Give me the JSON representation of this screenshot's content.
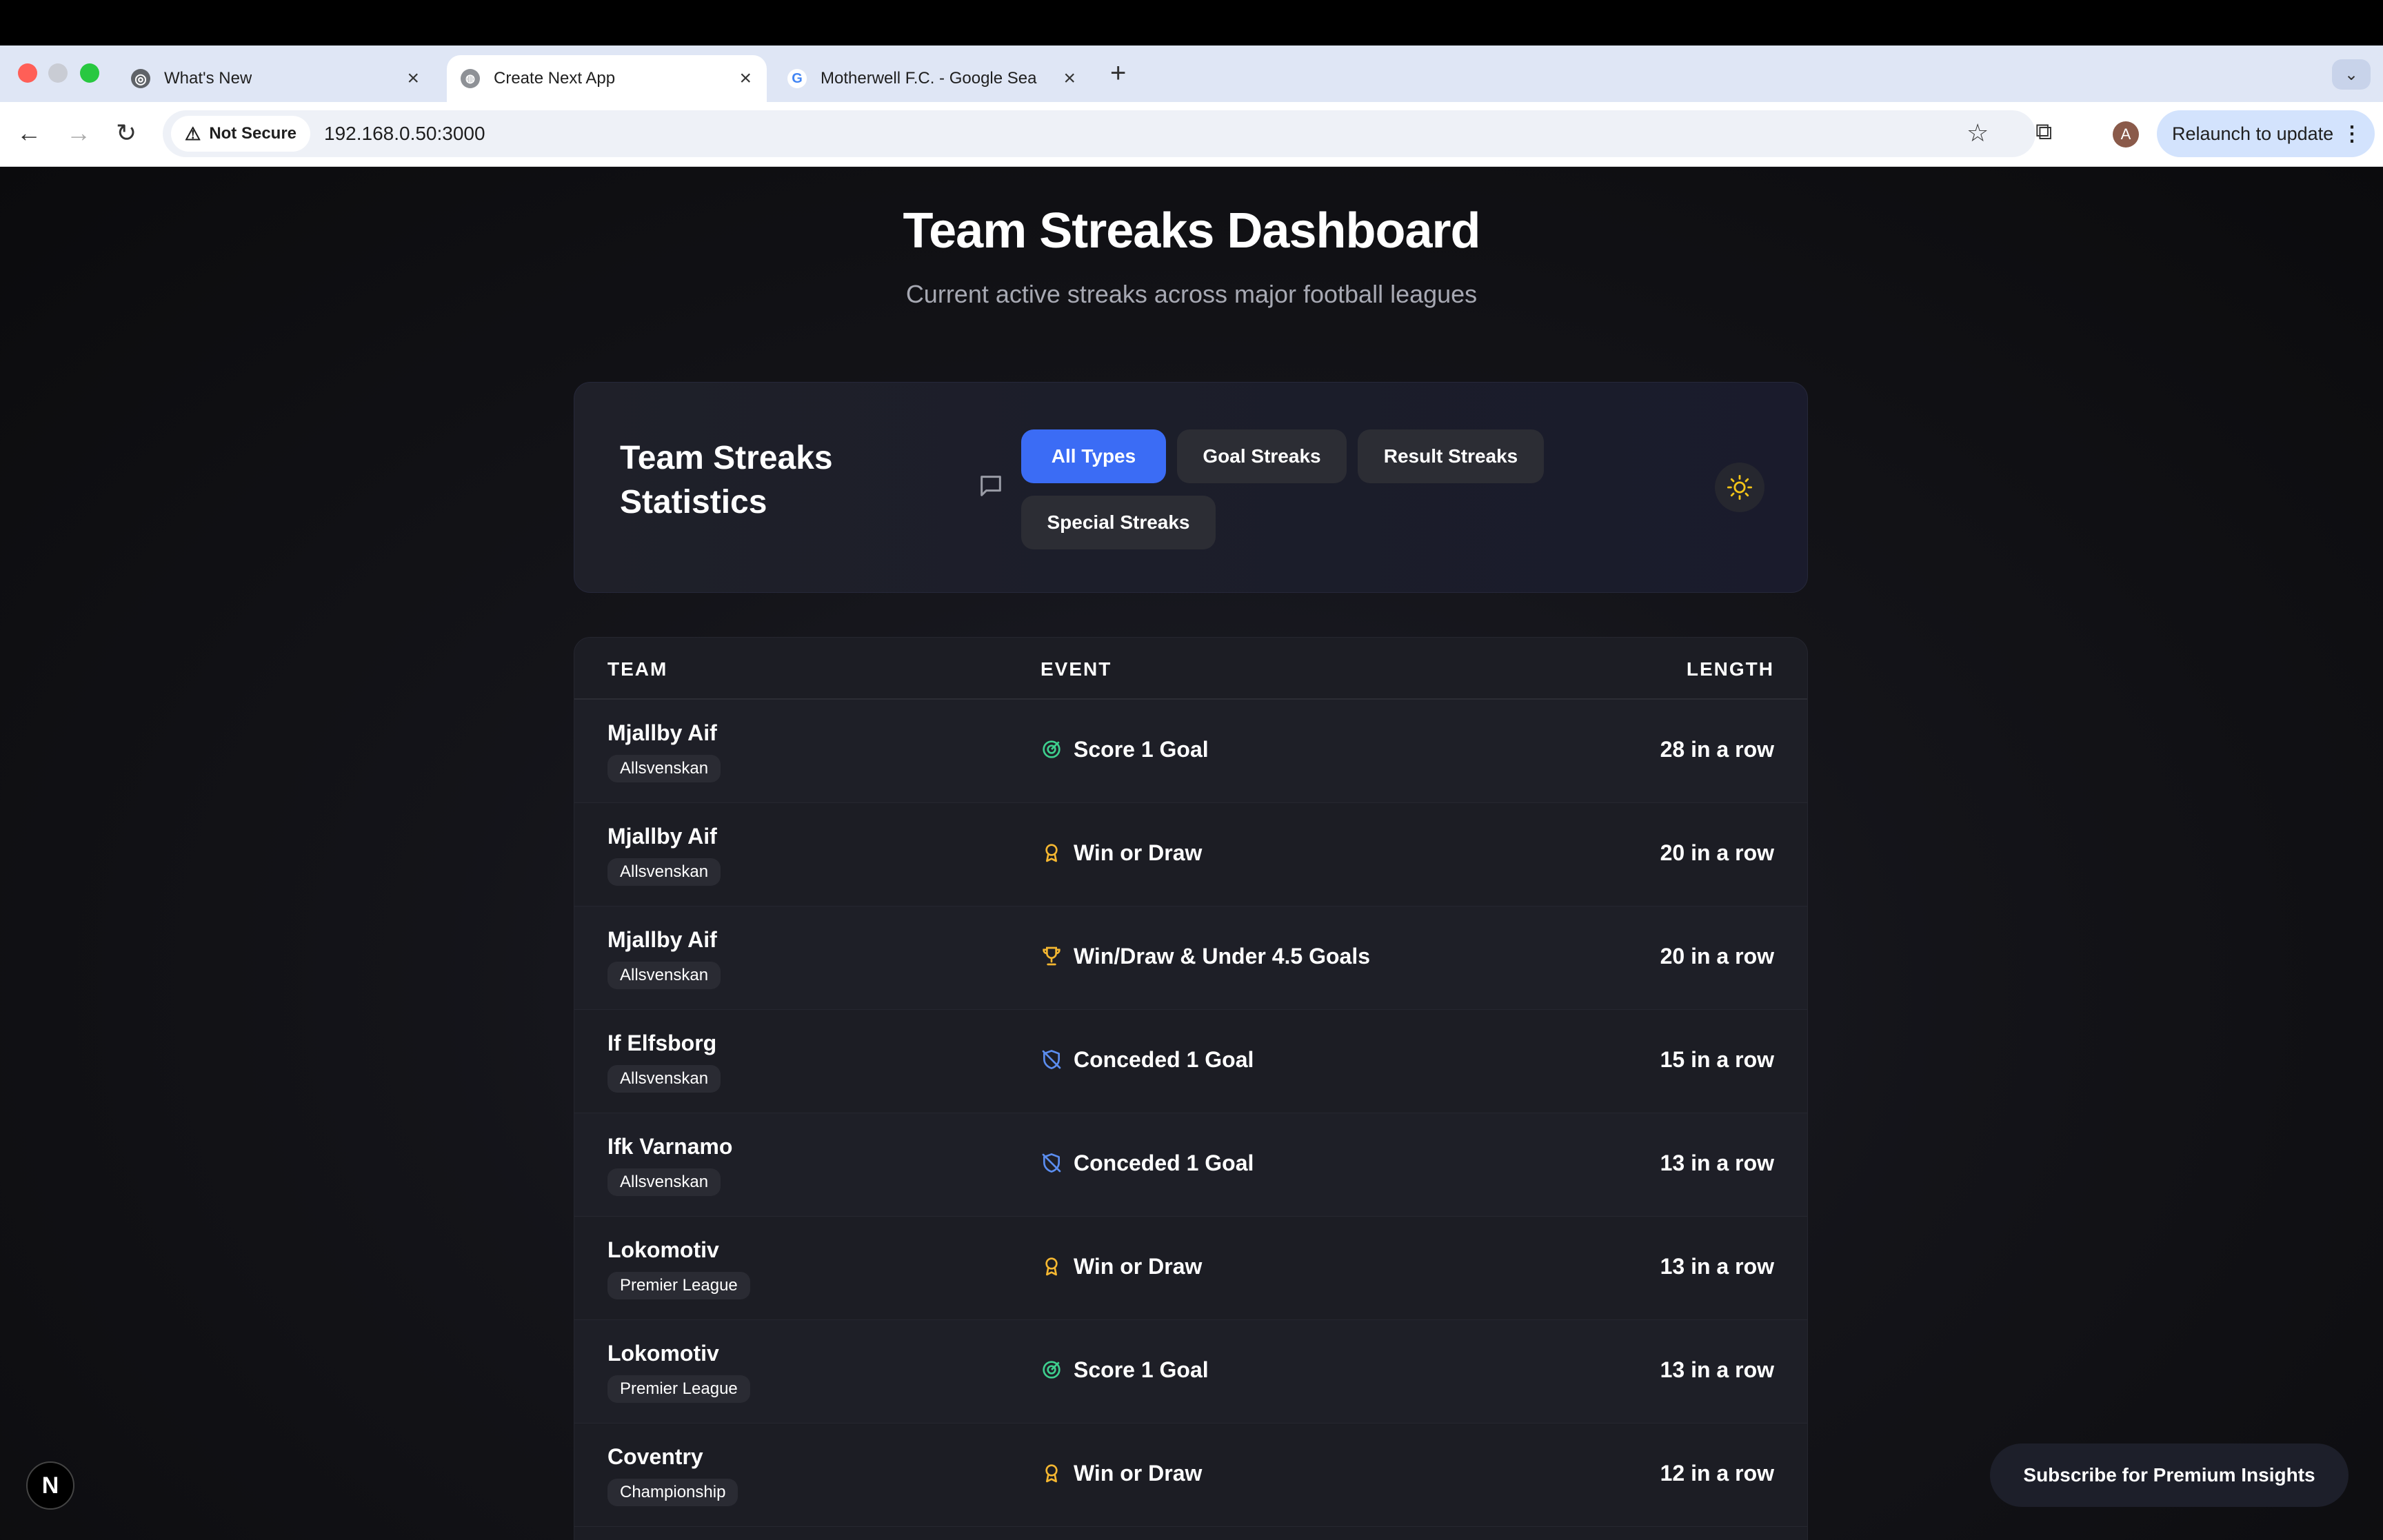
{
  "browser": {
    "tabs": [
      {
        "label": "What's New",
        "icon": "chrome-icon"
      },
      {
        "label": "Create Next App",
        "icon": "globe-icon"
      },
      {
        "label": "Motherwell F.C. - Google Sea",
        "icon": "google-icon"
      }
    ],
    "security_label": "Not Secure",
    "url": "192.168.0.50:3000",
    "profile_initial": "A",
    "relaunch_label": "Relaunch to update"
  },
  "page": {
    "title": "Team Streaks Dashboard",
    "subtitle": "Current active streaks across major football leagues"
  },
  "stats_card": {
    "title": "Team Streaks Statistics",
    "filters": [
      {
        "label": "All Types",
        "active": true
      },
      {
        "label": "Goal Streaks",
        "active": false
      },
      {
        "label": "Result Streaks",
        "active": false
      },
      {
        "label": "Special Streaks",
        "active": false
      }
    ]
  },
  "table": {
    "headers": {
      "team": "TEAM",
      "event": "EVENT",
      "length": "LENGTH"
    },
    "rows": [
      {
        "team": "Mjallby Aif",
        "league": "Allsvenskan",
        "event": "Score 1 Goal",
        "icon": "target-icon",
        "length": "28 in a row"
      },
      {
        "team": "Mjallby Aif",
        "league": "Allsvenskan",
        "event": "Win or Draw",
        "icon": "medal-icon",
        "length": "20 in a row"
      },
      {
        "team": "Mjallby Aif",
        "league": "Allsvenskan",
        "event": "Win/Draw & Under 4.5 Goals",
        "icon": "trophy-icon",
        "length": "20 in a row"
      },
      {
        "team": "If Elfsborg",
        "league": "Allsvenskan",
        "event": "Conceded 1 Goal",
        "icon": "shield-off-icon",
        "length": "15 in a row"
      },
      {
        "team": "Ifk Varnamo",
        "league": "Allsvenskan",
        "event": "Conceded 1 Goal",
        "icon": "shield-off-icon",
        "length": "13 in a row"
      },
      {
        "team": "Lokomotiv",
        "league": "Premier League",
        "event": "Win or Draw",
        "icon": "medal-icon",
        "length": "13 in a row"
      },
      {
        "team": "Lokomotiv",
        "league": "Premier League",
        "event": "Score 1 Goal",
        "icon": "target-icon",
        "length": "13 in a row"
      },
      {
        "team": "Coventry",
        "league": "Championship",
        "event": "Win or Draw",
        "icon": "medal-icon",
        "length": "12 in a row"
      }
    ]
  },
  "subscribe_label": "Subscribe for Premium Insights",
  "next_badge": "N",
  "colors": {
    "accent": "#3b6cf5",
    "goal_icon": "#3ecf8e",
    "result_icon": "#f5b731",
    "defense_icon": "#5b8def"
  }
}
